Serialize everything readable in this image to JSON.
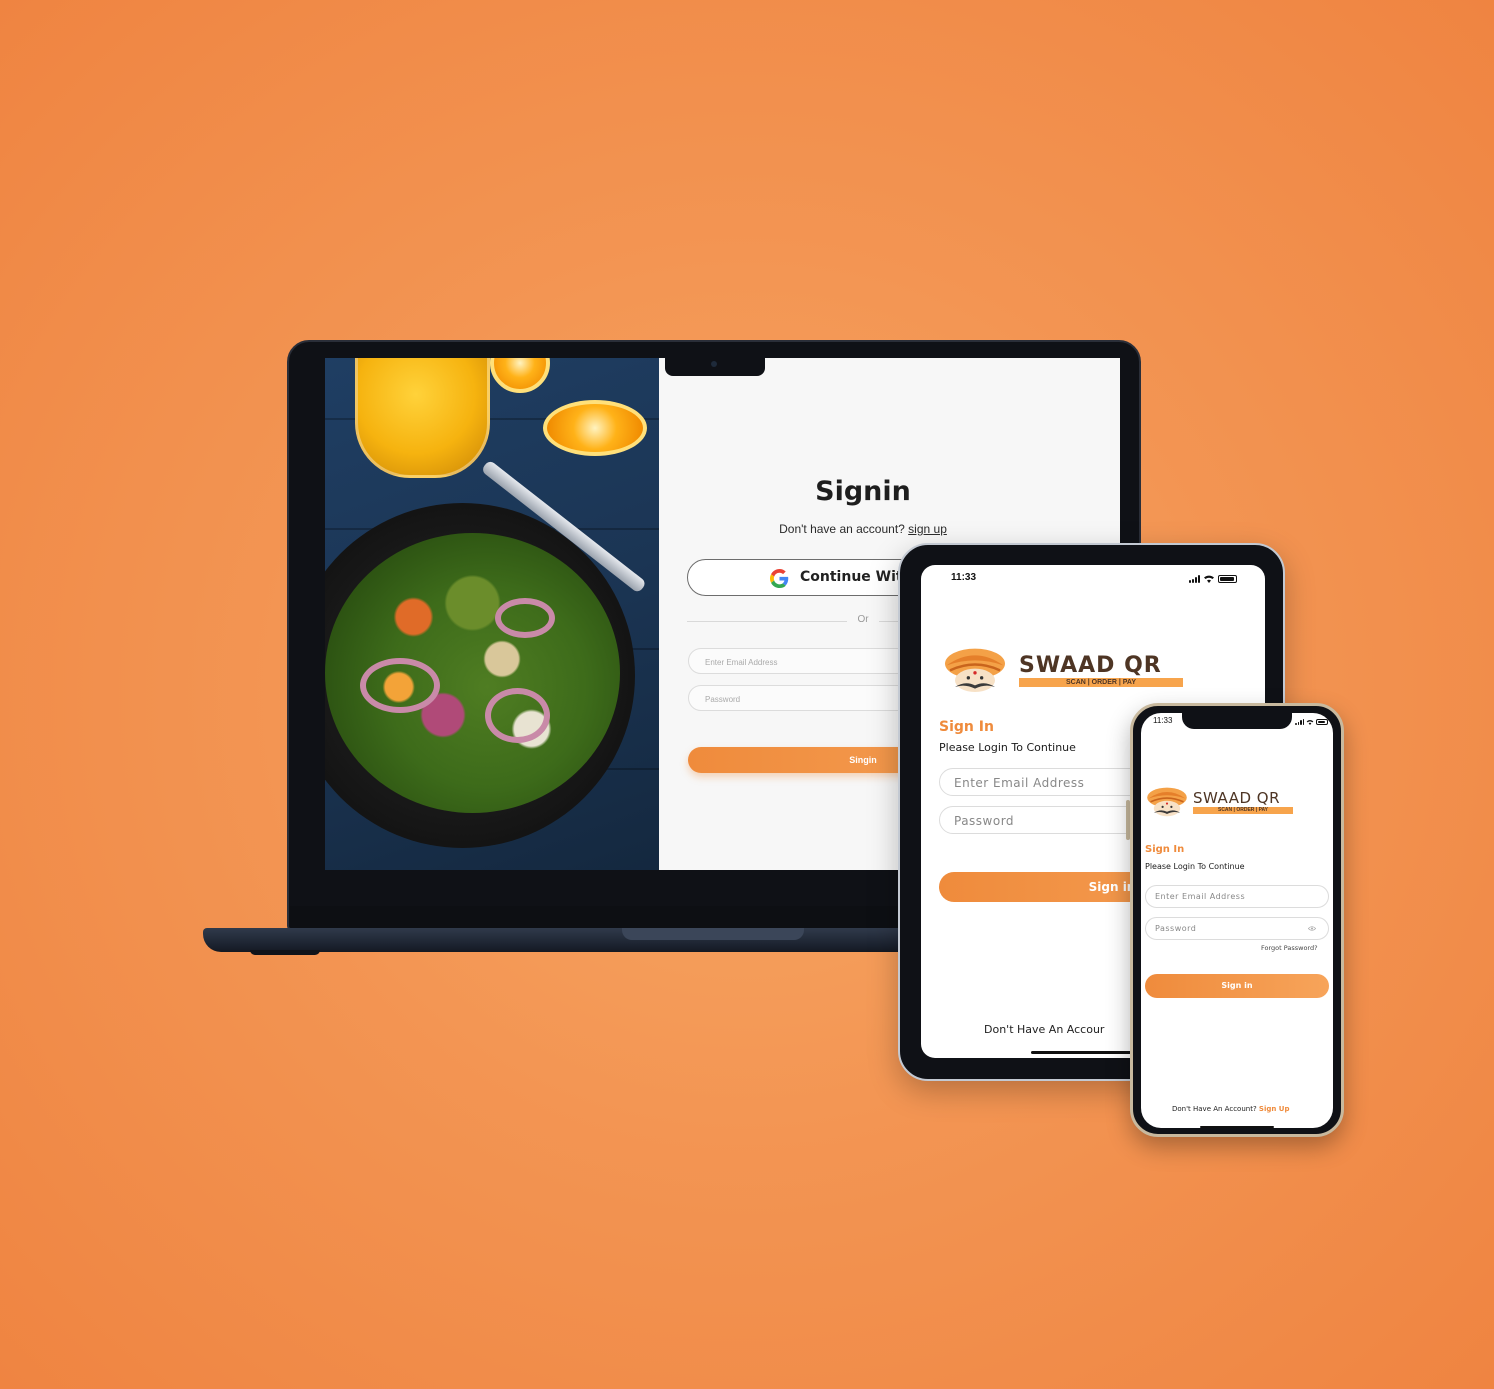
{
  "laptop": {
    "title": "Signin",
    "subtitle_prefix": "Don't have an account?",
    "subtitle_link": "sign up",
    "google_button": "Continue With",
    "divider": "Or",
    "email_placeholder": "Enter Email Address",
    "password_placeholder": "Password",
    "signin_button": "Singin"
  },
  "tablet": {
    "status_time": "11:33",
    "logo_name": "SWAAD QR",
    "logo_tagline": "SCAN | ORDER | PAY",
    "heading": "Sign In",
    "subheading": "Please Login To Continue",
    "email_placeholder": "Enter Email Address",
    "password_placeholder": "Password",
    "signin_button": "Sign in",
    "footer_prefix": "Don't Have An Accour"
  },
  "phone": {
    "status_time": "11:33",
    "logo_name": "SWAAD QR",
    "logo_tagline": "SCAN | ORDER | PAY",
    "heading": "Sign In",
    "subheading": "Please Login To Continue",
    "email_placeholder": "Enter Email Address",
    "password_placeholder": "Password",
    "forgot_password": "Forgot Password?",
    "signin_button": "Sign in",
    "footer_prefix": "Don't Have An Account?",
    "footer_link": "Sign Up"
  },
  "colors": {
    "background": "#f39553",
    "accent": "#ef8b3c",
    "brand_brown": "#4e3524",
    "tagline_bg": "#f7a44c"
  },
  "icons": [
    "google-icon",
    "camera-icon",
    "wifi-icon",
    "signal-icon",
    "battery-icon",
    "eye-icon",
    "turban-logo-icon"
  ]
}
